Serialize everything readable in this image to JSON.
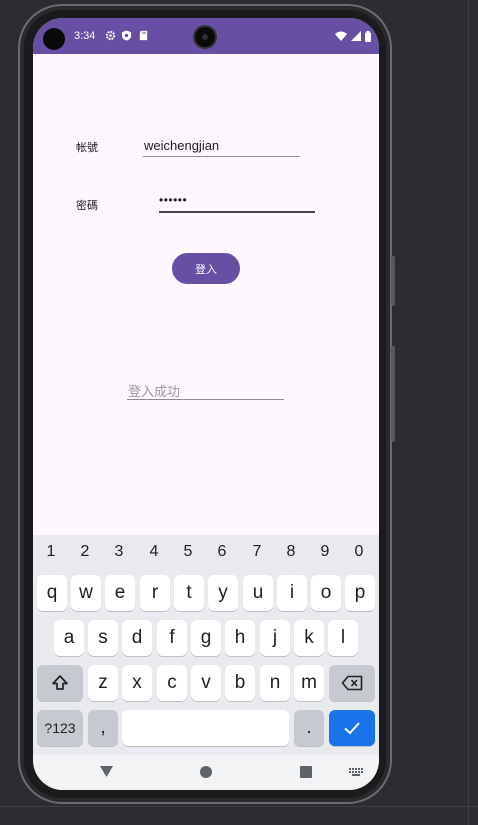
{
  "status_bar": {
    "time": "3:34"
  },
  "form": {
    "account_label": "帐號",
    "account_value": "weichengjian",
    "password_label": "密碼",
    "password_value": "••••••",
    "login_button": "登入",
    "result_placeholder": "登入成功"
  },
  "keyboard": {
    "numbers": [
      "1",
      "2",
      "3",
      "4",
      "5",
      "6",
      "7",
      "8",
      "9",
      "0"
    ],
    "row1": [
      "q",
      "w",
      "e",
      "r",
      "t",
      "y",
      "u",
      "i",
      "o",
      "p"
    ],
    "row2": [
      "a",
      "s",
      "d",
      "f",
      "g",
      "h",
      "j",
      "k",
      "l"
    ],
    "row3": [
      "z",
      "x",
      "c",
      "v",
      "b",
      "n",
      "m"
    ],
    "symbols_key": "?123",
    "comma_key": ",",
    "period_key": "."
  },
  "colors": {
    "accent": "#6750a4",
    "screen_bg": "#fef7fe",
    "enter_key": "#1a73e8"
  }
}
